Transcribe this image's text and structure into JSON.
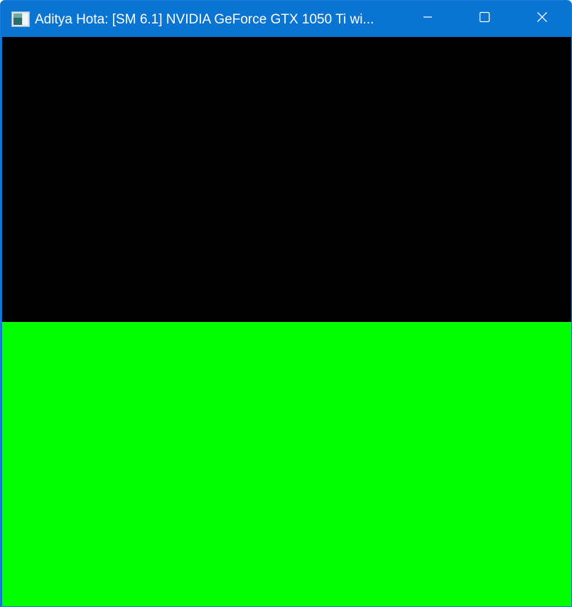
{
  "window": {
    "title": "Aditya Hota: [SM 6.1] NVIDIA GeForce GTX 1050 Ti wi...",
    "app_icon": "app-window-icon",
    "controls": {
      "minimize_icon": "minimize-icon",
      "maximize_icon": "maximize-icon",
      "close_icon": "close-icon"
    },
    "titlebar_color": "#0a74d2"
  },
  "client": {
    "top_region_color": "#000000",
    "bottom_region_color": "#00ff00"
  }
}
